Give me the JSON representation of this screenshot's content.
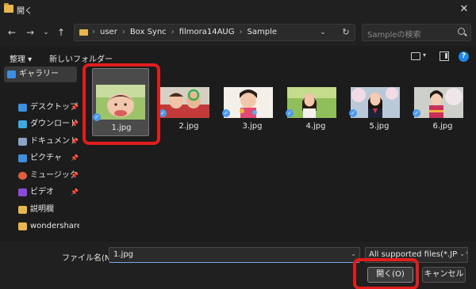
{
  "window": {
    "title": "開く",
    "close": "✕"
  },
  "nav": {
    "back": "←",
    "forward": "→",
    "dropdown": "⌄",
    "up": "↑"
  },
  "address": {
    "crumbs": [
      "user",
      "Box Sync",
      "filmora14AUG",
      "Sample"
    ],
    "separator": "›",
    "chevron": "⌄",
    "refresh": "↻"
  },
  "search": {
    "placeholder": "Sampleの検索"
  },
  "toolbar": {
    "organize": "整理 ▾",
    "new_folder": "新しいフォルダー",
    "view_chevron": "▾",
    "help": "?"
  },
  "sidebar": {
    "gallery": "ギャラリー",
    "items": [
      {
        "label": "デスクトップ",
        "icon": "desktop-icon",
        "color": "#3d8fe0"
      },
      {
        "label": "ダウンロード",
        "icon": "download-icon",
        "color": "#3da9e0"
      },
      {
        "label": "ドキュメント",
        "icon": "documents-icon",
        "color": "#8aa3c7"
      },
      {
        "label": "ピクチャ",
        "icon": "pictures-icon",
        "color": "#3d8fe0"
      },
      {
        "label": "ミュージック",
        "icon": "music-icon",
        "color": "#e0603d"
      },
      {
        "label": "ビデオ",
        "icon": "videos-icon",
        "color": "#8a4ad9"
      },
      {
        "label": "説明欄",
        "icon": "folder-icon",
        "color": "#e8b64c"
      },
      {
        "label": "wondershare",
        "icon": "folder-icon",
        "color": "#e8b64c"
      }
    ],
    "pin": "📌"
  },
  "files": [
    {
      "name": "1.jpg",
      "selected": true
    },
    {
      "name": "2.jpg",
      "selected": false
    },
    {
      "name": "3.jpg",
      "selected": false
    },
    {
      "name": "4.jpg",
      "selected": false
    },
    {
      "name": "5.jpg",
      "selected": false
    },
    {
      "name": "6.jpg",
      "selected": false
    }
  ],
  "check_mark": "✓",
  "footer": {
    "filename_label": "ファイル名(N):",
    "filename_value": "1.jpg",
    "filetype_value": "All supported files(*.JPG;*.",
    "chevron": "⌄",
    "open_button": "開く(O)",
    "cancel_button": "キャンセル"
  },
  "colors": {
    "accent": "#1e88e5",
    "highlight": "#e21d1d",
    "check": "#4c9aef"
  }
}
